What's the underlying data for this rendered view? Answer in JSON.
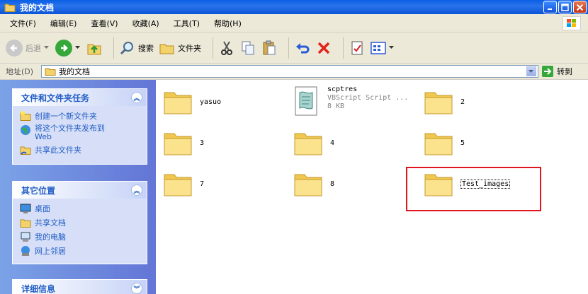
{
  "window": {
    "title": "我的文档"
  },
  "menu": [
    "文件(F)",
    "编辑(E)",
    "查看(V)",
    "收藏(A)",
    "工具(T)",
    "帮助(H)"
  ],
  "toolbar": {
    "back": "后退",
    "search": "搜索",
    "folders": "文件夹"
  },
  "address": {
    "label": "地址(D)",
    "value": "我的文档",
    "go": "转到"
  },
  "left_pane": {
    "file_tasks": {
      "title": "文件和文件夹任务",
      "items": [
        "创建一个新文件夹",
        "将这个文件夹发布到",
        "共享此文件夹"
      ],
      "publish_web": "Web"
    },
    "other_places": {
      "title": "其它位置",
      "items": [
        "桌面",
        "共享文档",
        "我的电脑",
        "网上邻居"
      ]
    },
    "details": {
      "title": "详细信息"
    }
  },
  "files": [
    {
      "name": "yasuo",
      "type": "folder"
    },
    {
      "name": "scptres",
      "type": "script",
      "desc": "VBScript Script ...",
      "size": "8 KB"
    },
    {
      "name": "2",
      "type": "folder"
    },
    {
      "name": "3",
      "type": "folder"
    },
    {
      "name": "4",
      "type": "folder"
    },
    {
      "name": "5",
      "type": "folder"
    },
    {
      "name": "7",
      "type": "folder"
    },
    {
      "name": "8",
      "type": "folder"
    },
    {
      "name": "Test_images",
      "type": "folder",
      "selected": true
    }
  ],
  "colors": {
    "accent": "#215dc6",
    "highlight_box": "#e0141e"
  }
}
